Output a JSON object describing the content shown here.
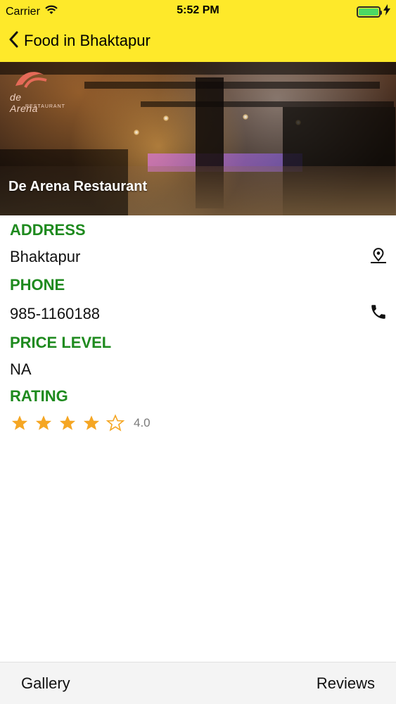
{
  "status_bar": {
    "carrier": "Carrier",
    "time": "5:52 PM",
    "battery_level_percent": 100,
    "battery_color": "#4CD964"
  },
  "nav": {
    "back_icon": "chevron-left-icon",
    "title": "Food in Bhaktapur"
  },
  "hero": {
    "title": "De Arena Restaurant",
    "logo_text": "de Arena",
    "logo_subtext": "RESTAURANT"
  },
  "details": {
    "address_label": "ADDRESS",
    "address_value": "Bhaktapur",
    "address_icon": "map-pin-icon",
    "phone_label": "PHONE",
    "phone_value": "985-1160188",
    "phone_icon": "phone-icon",
    "price_label": "PRICE LEVEL",
    "price_value": "NA",
    "rating_label": "RATING",
    "rating_value": "4.0",
    "rating_stars_filled": 4,
    "rating_stars_total": 5,
    "label_color": "#1E8A1E",
    "star_color": "#F5A623"
  },
  "bottom_bar": {
    "left_tab": "Gallery",
    "right_tab": "Reviews"
  },
  "colors": {
    "header_bg": "#FEE92A"
  }
}
